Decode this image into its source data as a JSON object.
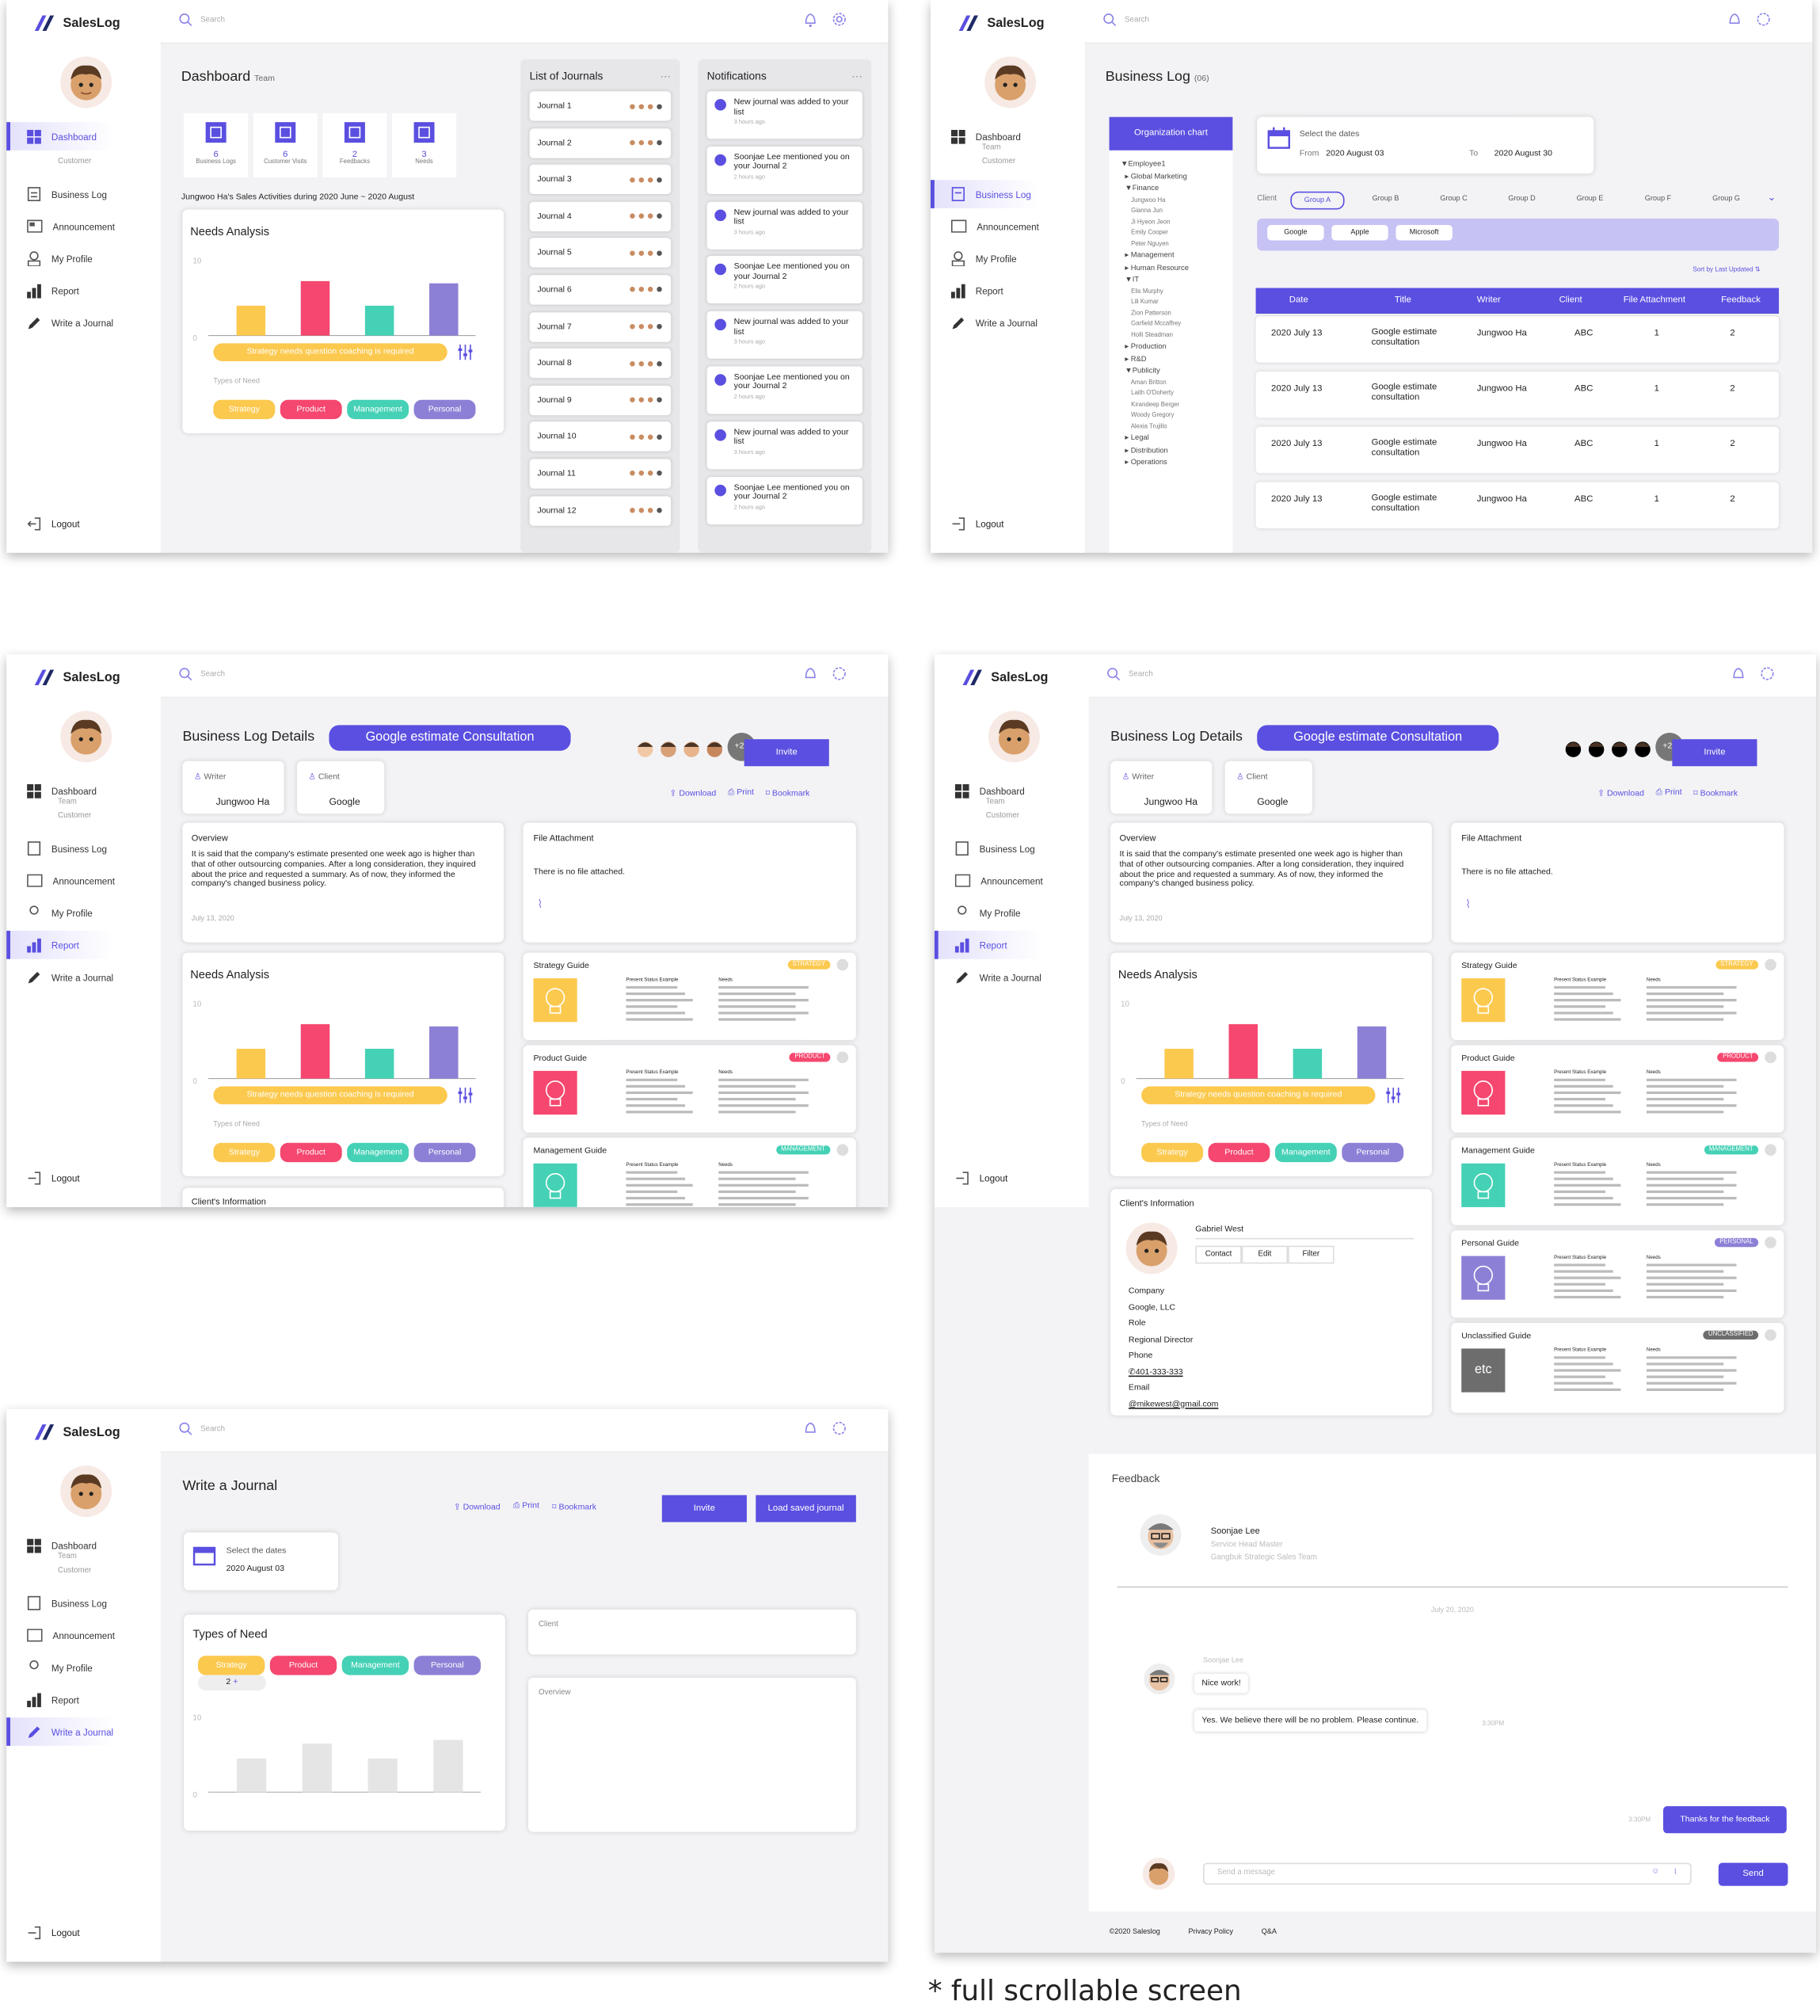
{
  "app": {
    "name": "SalesLog",
    "search_placeholder": "Search",
    "logout": "Logout"
  },
  "nav": {
    "dashboard": "Dashboard",
    "team": "Team",
    "customer": "Customer",
    "business_log": "Business Log",
    "announcement": "Announcement",
    "my_profile": "My Profile",
    "report": "Report",
    "write_journal": "Write a Journal"
  },
  "s1": {
    "title": "Dashboard",
    "title_sub": "Team",
    "stats": [
      {
        "value": "6",
        "label": "Business Logs"
      },
      {
        "value": "6",
        "label": "Customer Visits"
      },
      {
        "value": "2",
        "label": "Feedbacks"
      },
      {
        "value": "3",
        "label": "Needs"
      }
    ],
    "activities": "Jungwoo Ha's Sales Activities during 2020 June ~ 2020 August",
    "needs_title": "Needs Analysis",
    "y_top": "10",
    "y_zero": "0",
    "hint": "Strategy needs question coaching is required",
    "types_label": "Types of Need",
    "chips": [
      "Strategy",
      "Product",
      "Management",
      "Personal"
    ],
    "journals_title": "List of Journals",
    "journals": [
      "Journal 1",
      "Journal 2",
      "Journal 3",
      "Journal 4",
      "Journal 5",
      "Journal 6",
      "Journal 7",
      "Journal 8",
      "Journal 9",
      "Journal 10",
      "Journal  11",
      "Journal 12"
    ],
    "notifications_title": "Notifications",
    "notifications": [
      {
        "who": "",
        "text": "New journal was added to your list",
        "time": "3 hours ago"
      },
      {
        "who": "Soonjae Lee",
        "text": " mentioned you on your Journal 2",
        "time": "2 hours ago"
      },
      {
        "who": "",
        "text": "New journal was added to your list",
        "time": "3 hours ago"
      },
      {
        "who": "Soonjae Lee",
        "text": " mentioned you on your Journal 2",
        "time": "2 hours ago"
      },
      {
        "who": "",
        "text": "New journal was added to your list",
        "time": "3 hours ago"
      },
      {
        "who": "Soonjae Lee",
        "text": " mentioned you on your Journal 2",
        "time": "2 hours ago"
      },
      {
        "who": "",
        "text": "New journal was added to your list",
        "time": "3 hours ago"
      },
      {
        "who": "Soonjae Lee",
        "text": " mentioned you on your Journal 2",
        "time": "2 hours ago"
      }
    ]
  },
  "chart_data": {
    "type": "bar",
    "categories": [
      "Strategy",
      "Product",
      "Management",
      "Personal"
    ],
    "values": [
      4,
      7.3,
      4,
      7
    ],
    "colors": [
      "#fcc94f",
      "#f5476f",
      "#45d1b6",
      "#8c80d6"
    ],
    "ylim": [
      0,
      10
    ],
    "title": "Needs Analysis"
  },
  "s2": {
    "title": "Business Log",
    "title_sub": "(06)",
    "org_chart": "Organization chart",
    "tree": [
      "▼Employee1",
      "  ▸ Global Marketing",
      "  ▼Finance",
      "      Jungwoo Ha",
      "      Gianna Jun",
      "      Ji Hyeon Jeon",
      "      Emily Cooper",
      "      Peter Nguyen",
      "  ▸ Management",
      "  ▸ Human Resource",
      "  ▼IT",
      "      Elis Murphy",
      "      Lili Kumar",
      "      Zion Patterson",
      "      Garfield Mccaffrey",
      "      Holli Steadman",
      "  ▸ Production",
      "  ▸ R&D",
      "  ▼Publicity",
      "      Aman Britton",
      "      Laith O'Doherty",
      "      Kirandeep Berger",
      "      Woody Gregory",
      "      Alexia Trujillo",
      "  ▸ Legal",
      "  ▸ Distribution",
      "  ▸ Operations"
    ],
    "select_dates": "Select the dates",
    "from": "From",
    "from_date": "2020 August 03",
    "to": "To",
    "to_date": "2020 August 30",
    "client_label": "Client",
    "groups": [
      "Group A",
      "Group B",
      "Group C",
      "Group D",
      "Group E",
      "Group F",
      "Group G"
    ],
    "companies": [
      "Google",
      "Apple",
      "Microsoft"
    ],
    "sort": "Sort by Last Updated",
    "headers": [
      "Date",
      "Title",
      "Writer",
      "Client",
      "File Attachment",
      "Feedback"
    ],
    "rows": [
      [
        "2020 July 13",
        "Google estimate consultation",
        "Jungwoo Ha",
        "ABC",
        "1",
        "2"
      ],
      [
        "2020 July 13",
        "Google estimate consultation",
        "Jungwoo Ha",
        "ABC",
        "1",
        "2"
      ],
      [
        "2020 July 13",
        "Google estimate consultation",
        "Jungwoo Ha",
        "ABC",
        "1",
        "2"
      ],
      [
        "2020 July 13",
        "Google estimate consultation",
        "Jungwoo Ha",
        "ABC",
        "1",
        "2"
      ]
    ]
  },
  "details": {
    "title": "Business Log Details",
    "pill": "Google estimate Consultation",
    "more": "+25",
    "invite": "Invite",
    "download": "Download",
    "print": "Print",
    "bookmark": "Bookmark",
    "writer_label": "Writer",
    "writer": "Jungwoo Ha",
    "client_label": "Client",
    "client": "Google",
    "overview_title": "Overview",
    "overview": "It is said that the company's estimate presented one week ago is higher than that of other outsourcing companies. After a long consideration, they inquired about the price and requested a summary. As of now, they informed the company's changed business policy.",
    "overview_date": "July 13, 2020",
    "file_title": "File Attachment",
    "file_text": "There is no file attached.",
    "guides": [
      {
        "title": "Strategy Guide",
        "badge": "STRATEGY"
      },
      {
        "title": "Product Guide",
        "badge": "PRODUCT"
      },
      {
        "title": "Management Guide",
        "badge": "MANAGEMENT"
      },
      {
        "title": "Personal Guide",
        "badge": "PERSONAL"
      },
      {
        "title": "Unclassified Guide",
        "badge": "UNCLASSIFIED"
      }
    ],
    "present_label": "Present Status Example",
    "needs_label": "Needs",
    "etc": "etc",
    "clients_info": "Client's Information",
    "clients_info_cut": "Client's Information",
    "client_name": "Gabriel West",
    "tabs": [
      "Contact",
      "Edit",
      "Filter"
    ],
    "company_label": "Company",
    "company": "Google, LLC",
    "role_label": "Role",
    "role": "Regional Director",
    "phone_label": "Phone",
    "phone": "401-333-333",
    "email_label": "Email",
    "email": "mikewest@gmail.com"
  },
  "feedback": {
    "title": "Feedback",
    "name": "Soonjae Lee",
    "role": "Service Head Master",
    "team": "Gangbuk Strategic Sales Team",
    "date": "July 20, 2020",
    "sender": "Soonjae Lee",
    "msg1": "Nice work!",
    "msg2": "Yes. We believe there will be no problem. Please continue.",
    "time1": "3:30PM",
    "reply": "Thanks for the feedback",
    "time2": "3:30PM",
    "placeholder": "Send a message",
    "send": "Send"
  },
  "footer": {
    "copy": "©2020 Saleslog",
    "privacy": "Privacy Policy",
    "qa": "Q&A"
  },
  "write": {
    "title": "Write a Journal",
    "download": "Download",
    "print": "Print",
    "bookmark": "Bookmark",
    "invite": "Invite",
    "load": "Load saved journal",
    "select_dates": "Select the dates",
    "date": "2020 August 03",
    "types": "Types of Need",
    "counter": "2",
    "client": "Client",
    "overview": "Overview"
  },
  "caption": "* full scrollable screen",
  "colors": {
    "accent": "#5a4fe0",
    "strategy": "#fcc94f",
    "product": "#f5476f",
    "management": "#45d1b6",
    "personal": "#8c80d6"
  }
}
